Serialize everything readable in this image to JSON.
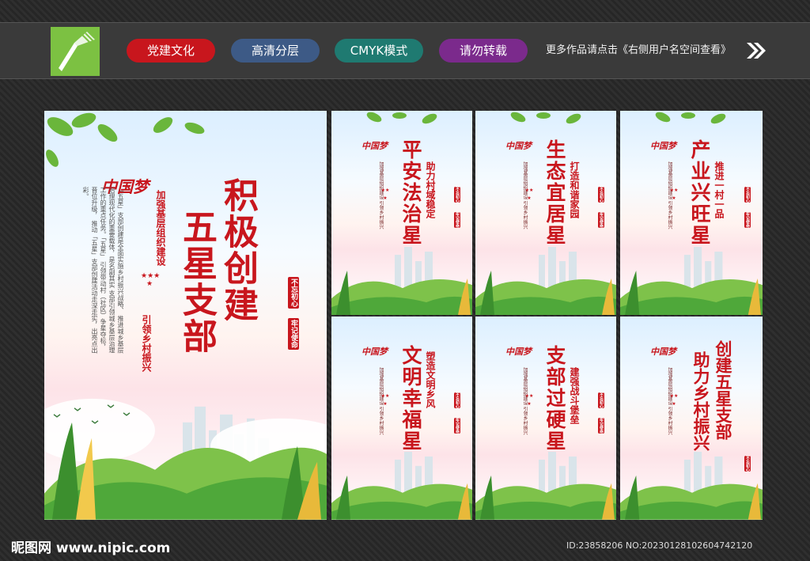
{
  "header": {
    "tags": [
      {
        "label": "党建文化",
        "color": "#c8161d"
      },
      {
        "label": "高清分层",
        "color": "#3d5a86"
      },
      {
        "label": "CMYK模式",
        "color": "#1f7a71"
      },
      {
        "label": "请勿转载",
        "color": "#7b2a8c"
      }
    ],
    "more_text": "更多作品请点击《右侧用户名空间查看》"
  },
  "main_poster": {
    "dream_logo": "中国梦",
    "title_line1": "积极创建",
    "title_line2": "五星支部",
    "sub_line1": "加强基层组织建设",
    "sub_line2": "引领乡村振兴",
    "seal_1": "不忘初心",
    "seal_2": "牢记使命",
    "body": [
      "「五星」支部创建是全面实施乡村振兴战略、",
      "推进城乡基层治理现代化的重要载体，是名副其实",
      "支部引领城乡基层治理工作的重点任务。「五星」",
      "引领带动村（社区）争星夺标，晋位升级，",
      "推动「五星」支部创建活动走深走实，出亮点出彩。"
    ]
  },
  "small_posters": [
    {
      "title": "平安法治星",
      "subtitle": "助力村域稳定",
      "tiny": "加强基层组织建设 引领乡村振兴"
    },
    {
      "title": "生态宜居星",
      "subtitle": "打造和谐家园",
      "tiny": "加强基层组织建设 引领乡村振兴"
    },
    {
      "title": "产业兴旺星",
      "subtitle": "推进一村一品",
      "tiny": "加强基层组织建设 引领乡村振兴"
    },
    {
      "title": "文明幸福星",
      "subtitle": "塑造文明乡风",
      "tiny": "加强基层组织建设 引领乡村振兴"
    },
    {
      "title": "支部过硬星",
      "subtitle": "建强战斗堡垒",
      "tiny": "加强基层组织建设 引领乡村振兴"
    },
    {
      "title_line1": "创建五星支部",
      "title_line2": "助力乡村振兴",
      "tiny": "加强基层组织建设 引领乡村振兴"
    }
  ],
  "small_seal_1": "不忘初心",
  "small_seal_2": "牢记使命",
  "footer": {
    "site": "昵图网 www.nipic.com",
    "id": "ID:23858206 NO:20230128102604742120"
  }
}
